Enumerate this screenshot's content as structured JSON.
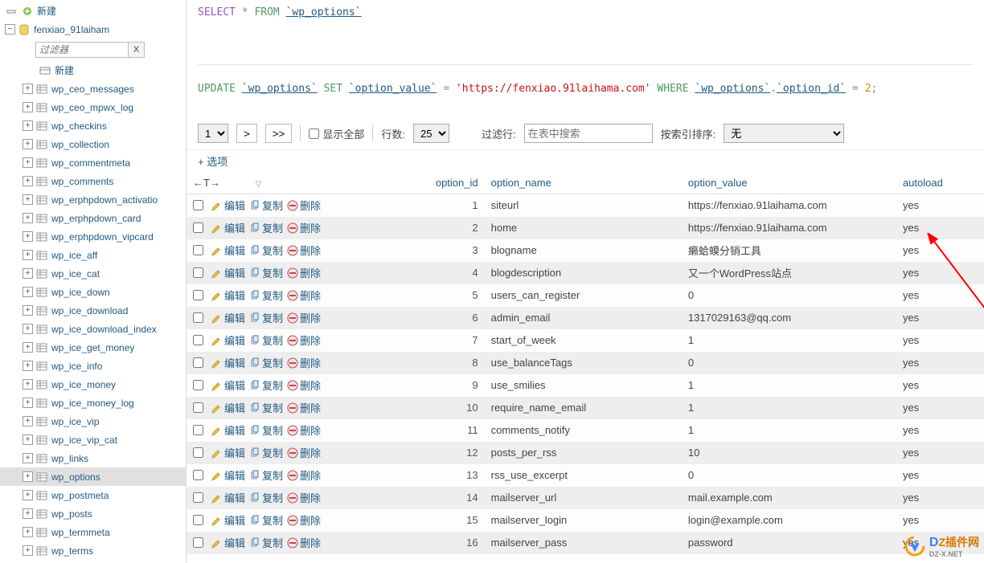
{
  "sidebar": {
    "new_label": "新建",
    "db_name": "fenxiao_91laiham",
    "filter_placeholder": "过滤器",
    "new_table_label": "新建",
    "tables": [
      "wp_ceo_messages",
      "wp_ceo_mpwx_log",
      "wp_checkins",
      "wp_collection",
      "wp_commentmeta",
      "wp_comments",
      "wp_erphpdown_activatio",
      "wp_erphpdown_card",
      "wp_erphpdown_vipcard",
      "wp_ice_aff",
      "wp_ice_cat",
      "wp_ice_down",
      "wp_ice_download",
      "wp_ice_download_index",
      "wp_ice_get_money",
      "wp_ice_info",
      "wp_ice_money",
      "wp_ice_money_log",
      "wp_ice_vip",
      "wp_ice_vip_cat",
      "wp_links",
      "wp_options",
      "wp_postmeta",
      "wp_posts",
      "wp_termmeta",
      "wp_terms"
    ],
    "selected_index": 21
  },
  "sql": {
    "select_query_parts": {
      "from": "FROM",
      "table": "`wp_options`"
    },
    "update_query_parts": {
      "update": "UPDATE",
      "table1": "`wp_options`",
      "set": "SET",
      "col1": "`option_value`",
      "eq": " = ",
      "valstr": "'https://fenxiao.91laihama.com'",
      "where": "WHERE",
      "table2": "`wp_options`",
      "dot": ".",
      "col2": "`option_id`",
      "eq2": " = ",
      "num": "2",
      "semi": ";"
    }
  },
  "toolbar": {
    "page_select": "1",
    "next": ">",
    "last": ">>",
    "show_all": "显示全部",
    "rows_label": "行数:",
    "rows_value": "25",
    "filter_label": "过滤行:",
    "filter_placeholder": "在表中搜索",
    "sort_label": "按索引排序:",
    "sort_value": "无"
  },
  "options_link": "+ 选项",
  "table_headers": {
    "sort_col": "←T→",
    "option_id": "option_id",
    "option_name": "option_name",
    "option_value": "option_value",
    "autoload": "autoload"
  },
  "actions": {
    "edit": "编辑",
    "copy": "复制",
    "delete": "删除"
  },
  "rows": [
    {
      "id": "1",
      "name": "siteurl",
      "value": "https://fenxiao.91laihama.com",
      "autoload": "yes"
    },
    {
      "id": "2",
      "name": "home",
      "value": "https://fenxiao.91laihama.com",
      "autoload": "yes"
    },
    {
      "id": "3",
      "name": "blogname",
      "value": "癞蛤蟆分销工具",
      "autoload": "yes"
    },
    {
      "id": "4",
      "name": "blogdescription",
      "value": "又一个WordPress站点",
      "autoload": "yes"
    },
    {
      "id": "5",
      "name": "users_can_register",
      "value": "0",
      "autoload": "yes"
    },
    {
      "id": "6",
      "name": "admin_email",
      "value": "1317029163@qq.com",
      "autoload": "yes"
    },
    {
      "id": "7",
      "name": "start_of_week",
      "value": "1",
      "autoload": "yes"
    },
    {
      "id": "8",
      "name": "use_balanceTags",
      "value": "0",
      "autoload": "yes"
    },
    {
      "id": "9",
      "name": "use_smilies",
      "value": "1",
      "autoload": "yes"
    },
    {
      "id": "10",
      "name": "require_name_email",
      "value": "1",
      "autoload": "yes"
    },
    {
      "id": "11",
      "name": "comments_notify",
      "value": "1",
      "autoload": "yes"
    },
    {
      "id": "12",
      "name": "posts_per_rss",
      "value": "10",
      "autoload": "yes"
    },
    {
      "id": "13",
      "name": "rss_use_excerpt",
      "value": "0",
      "autoload": "yes"
    },
    {
      "id": "14",
      "name": "mailserver_url",
      "value": "mail.example.com",
      "autoload": "yes"
    },
    {
      "id": "15",
      "name": "mailserver_login",
      "value": "login@example.com",
      "autoload": "yes"
    },
    {
      "id": "16",
      "name": "mailserver_pass",
      "value": "password",
      "autoload": "yes"
    }
  ],
  "watermark": {
    "main": "DZ插件网",
    "sub": "DZ-X.NET"
  }
}
